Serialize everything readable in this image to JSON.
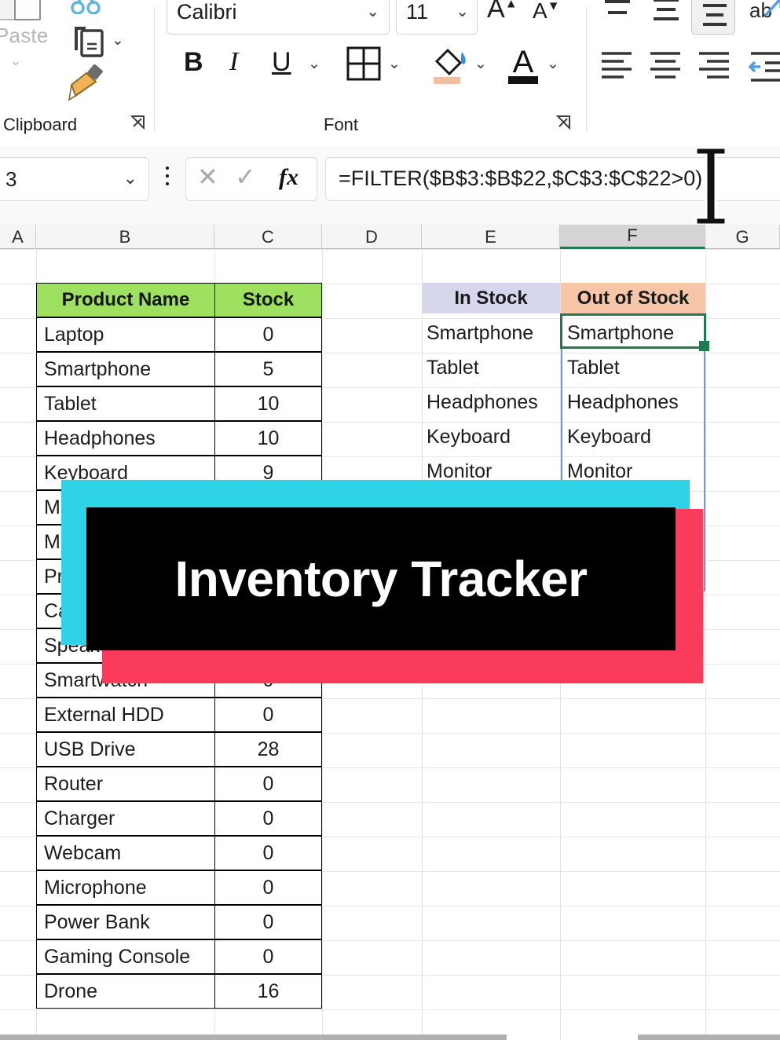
{
  "ribbon": {
    "clipboard": {
      "group_label": "Clipboard",
      "paste_label": "Paste",
      "dialog_launcher": "⌐",
      "cut_name": "cut-icon",
      "copy_name": "copy-icon",
      "format_painter_name": "format-painter-icon"
    },
    "font": {
      "group_label": "Font",
      "font_name": "Calibri",
      "font_size": "11",
      "grow_font": "A",
      "shrink_font": "A",
      "bold": "B",
      "italic": "I",
      "underline": "U",
      "dialog_launcher": "⌐",
      "caret": "⌄"
    },
    "alignment": {
      "top_align": "align-top",
      "middle_align": "align-middle",
      "bottom_align": "align-bottom",
      "wrap_text": "wrap-text",
      "align_left": "align-left",
      "align_center": "align-center",
      "align_right": "align-right",
      "decrease_indent": "decrease-indent"
    }
  },
  "formula_bar": {
    "name_box_value": "3",
    "cancel": "✕",
    "enter": "✓",
    "insert_function": "fx",
    "formula": "=FILTER($B$3:$B$22,$C$3:$C$22>0)",
    "kebab": "⋮",
    "caret": "⌄"
  },
  "grid": {
    "column_headers": [
      "A",
      "B",
      "C",
      "D",
      "E",
      "F",
      "G"
    ],
    "active_column": "F"
  },
  "source_table": {
    "headers": [
      "Product Name",
      "Stock"
    ],
    "header_fill": "#9EE060",
    "rows": [
      {
        "name": "Laptop",
        "stock": "0"
      },
      {
        "name": "Smartphone",
        "stock": "5"
      },
      {
        "name": "Tablet",
        "stock": "10"
      },
      {
        "name": "Headphones",
        "stock": "10"
      },
      {
        "name": "Keyboard",
        "stock": "9"
      },
      {
        "name": "Monitor",
        "stock": ""
      },
      {
        "name": "Mouse",
        "stock": ""
      },
      {
        "name": "Printer",
        "stock": ""
      },
      {
        "name": "Camera",
        "stock": ""
      },
      {
        "name": "Speaker",
        "stock": ""
      },
      {
        "name": "Smartwatch",
        "stock": "0"
      },
      {
        "name": "External HDD",
        "stock": "0"
      },
      {
        "name": "USB Drive",
        "stock": "28"
      },
      {
        "name": "Router",
        "stock": "0"
      },
      {
        "name": "Charger",
        "stock": "0"
      },
      {
        "name": "Webcam",
        "stock": "0"
      },
      {
        "name": "Microphone",
        "stock": "0"
      },
      {
        "name": "Power Bank",
        "stock": "0"
      },
      {
        "name": "Gaming Console",
        "stock": "0"
      },
      {
        "name": "Drone",
        "stock": "16"
      }
    ]
  },
  "result_tables": {
    "in_stock": {
      "header": "In Stock",
      "header_fill": "#D6D6EC",
      "values": [
        "Smartphone",
        "Tablet",
        "Headphones",
        "Keyboard",
        "Monitor"
      ]
    },
    "out_of_stock": {
      "header": "Out of Stock",
      "header_fill": "#F7C6A8",
      "values": [
        "Smartphone",
        "Tablet",
        "Headphones",
        "Keyboard",
        "Monitor"
      ]
    }
  },
  "overlay": {
    "title": "Inventory Tracker",
    "cyan": "#2ED3E8",
    "red": "#FB3B5C",
    "black": "#000000",
    "text_color": "#FFFFFF"
  }
}
